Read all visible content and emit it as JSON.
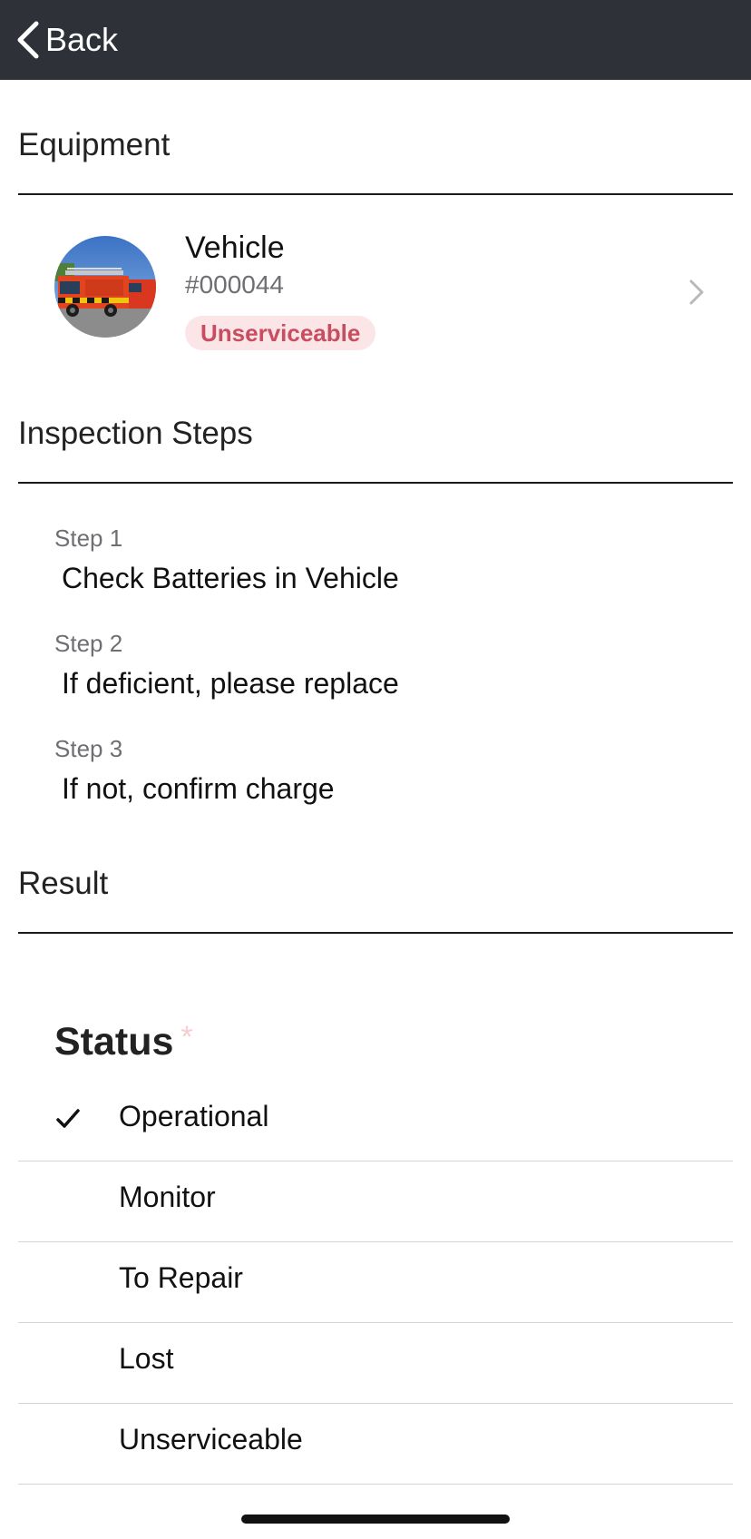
{
  "navbar": {
    "back_label": "Back"
  },
  "equipment": {
    "section_title": "Equipment",
    "name": "Vehicle",
    "id": "#000044",
    "status": "Unserviceable",
    "status_color": "#c94d60"
  },
  "inspection": {
    "section_title": "Inspection Steps",
    "steps": [
      {
        "label": "Step 1",
        "text": "Check Batteries in Vehicle"
      },
      {
        "label": "Step 2",
        "text": "If deficient, please replace"
      },
      {
        "label": "Step 3",
        "text": "If not, confirm charge"
      }
    ]
  },
  "result": {
    "section_title": "Result",
    "status_heading": "Status",
    "required_mark": "*",
    "selected": "Operational",
    "options": [
      {
        "label": "Operational"
      },
      {
        "label": "Monitor"
      },
      {
        "label": "To Repair"
      },
      {
        "label": "Lost"
      },
      {
        "label": "Unserviceable"
      }
    ]
  },
  "icons": [
    "chevron-left-icon",
    "chevron-right-icon",
    "checkmark-icon"
  ],
  "colors": {
    "navbar": "#2f3139",
    "badge_bg": "#fbe5e7",
    "accent_text": "#c94d60"
  }
}
